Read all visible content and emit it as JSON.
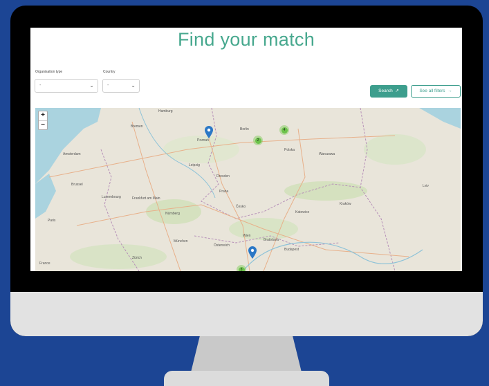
{
  "page": {
    "title": "Find your match"
  },
  "filters": {
    "organisation_type": {
      "label": "Organisation type",
      "value": "-"
    },
    "country": {
      "label": "Country",
      "value": "-"
    }
  },
  "buttons": {
    "search": "Search",
    "see_all_filters": "See all filters"
  },
  "map": {
    "zoom_in": "+",
    "zoom_out": "−",
    "clusters": [
      "2",
      "4",
      "3"
    ],
    "labels": [
      "Hamburg",
      "Bremen",
      "Amsterdam",
      "Berlin",
      "Poznań",
      "Warszawa",
      "Leipzig",
      "Dresden",
      "Praha",
      "Kraków",
      "Frankfurt am Main",
      "Nürnberg",
      "München",
      "Wien",
      "Bratislava",
      "Budapest",
      "Paris",
      "Luxembourg",
      "Brussel",
      "Katowice",
      "Österreich",
      "Polska",
      "Česko",
      "France",
      "Zürich",
      "Lviv"
    ]
  },
  "colors": {
    "accent": "#3d9e8d",
    "title": "#47a88e",
    "background": "#1c4594",
    "cluster": "#6cc24a",
    "pin": "#2b78c6"
  }
}
